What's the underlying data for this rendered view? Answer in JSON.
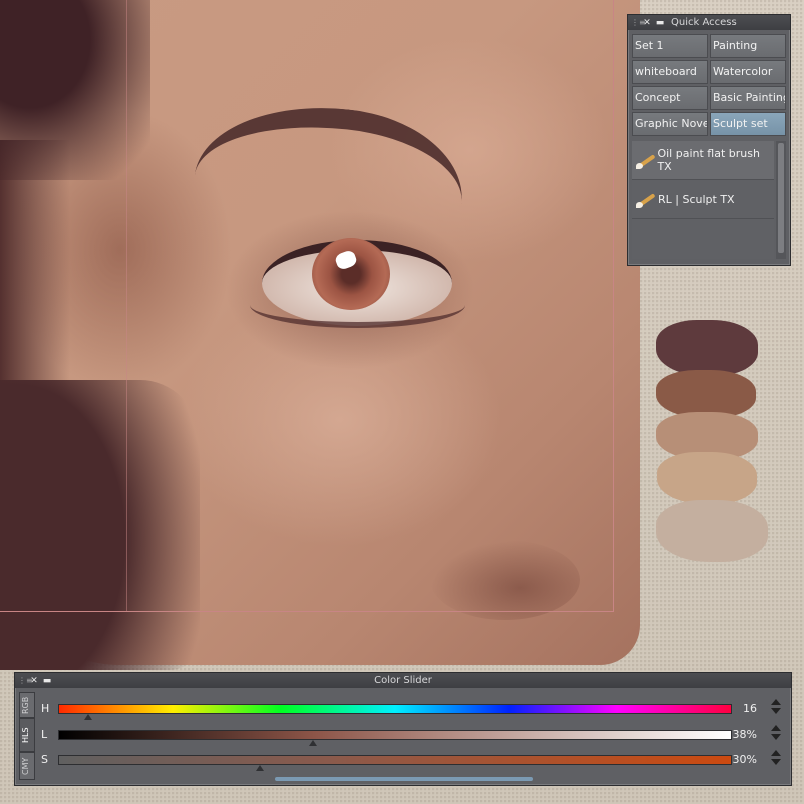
{
  "quick_access": {
    "title": "Quick Access",
    "sets": [
      {
        "label": "Set 1",
        "active": false
      },
      {
        "label": "Painting",
        "active": false
      },
      {
        "label": "whiteboard",
        "active": false
      },
      {
        "label": "Watercolor",
        "active": false
      },
      {
        "label": "Concept",
        "active": false
      },
      {
        "label": "Basic Painting",
        "active": false
      },
      {
        "label": "Graphic Novel",
        "active": false
      },
      {
        "label": "Sculpt set",
        "active": true
      }
    ],
    "tools": [
      {
        "label": "Oil paint flat brush TX",
        "icon": "brush-icon"
      },
      {
        "label": "RL | Sculpt TX",
        "icon": "brush-icon"
      }
    ]
  },
  "color_slider": {
    "title": "Color Slider",
    "tabs": [
      "RGB",
      "HLS",
      "CMY"
    ],
    "active_tab": "HLS",
    "rows": [
      {
        "label": "H",
        "value": "16",
        "fraction": 0.044
      },
      {
        "label": "L",
        "value": "38%",
        "fraction": 0.38
      },
      {
        "label": "S",
        "value": "30%",
        "fraction": 0.3
      }
    ]
  },
  "swatches": [
    "#5e3a3d",
    "#8a5a47",
    "#b78f77",
    "#c7a588",
    "#c4af9f",
    "#cbb9a4"
  ],
  "colors": {
    "panel_bg": "#5f6064",
    "active_set": "#7f9bb0",
    "canvas_frame": "#c88585"
  }
}
